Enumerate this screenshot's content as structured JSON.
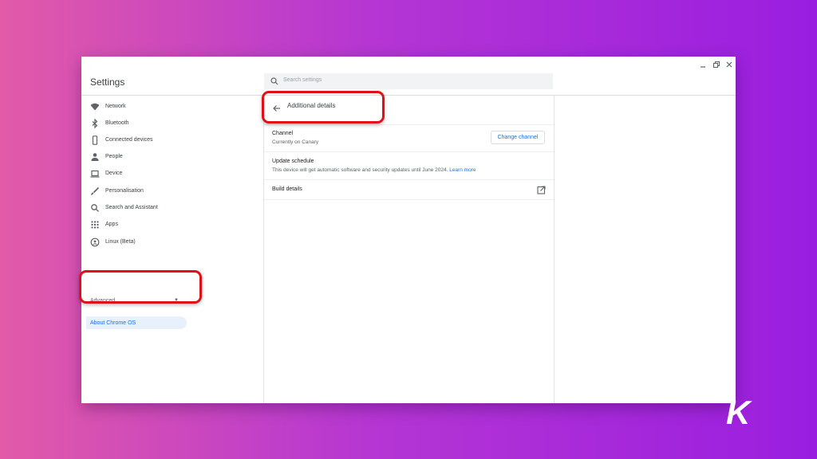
{
  "window": {
    "title": "Settings",
    "search_placeholder": "Search settings",
    "controls": [
      "minimize-icon",
      "restore-icon",
      "close-icon"
    ]
  },
  "sidebar": {
    "items": [
      {
        "label": "Network",
        "icon": "wifi-icon"
      },
      {
        "label": "Bluetooth",
        "icon": "bluetooth-icon"
      },
      {
        "label": "Connected devices",
        "icon": "phone-icon"
      },
      {
        "label": "People",
        "icon": "person-icon"
      },
      {
        "label": "Device",
        "icon": "laptop-icon"
      },
      {
        "label": "Personalisation",
        "icon": "brush-icon"
      },
      {
        "label": "Search and Assistant",
        "icon": "search-icon"
      },
      {
        "label": "Apps",
        "icon": "apps-grid-icon"
      },
      {
        "label": "Linux (Beta)",
        "icon": "linux-icon"
      }
    ],
    "advanced_label": "Advanced",
    "about_label": "About Chrome OS"
  },
  "main": {
    "subpage_title": "Additional details",
    "channel": {
      "label": "Channel",
      "value": "Currently on Canary",
      "button": "Change channel"
    },
    "update_schedule": {
      "label": "Update schedule",
      "text": "This device will get automatic software and security updates until June 2024.",
      "link": "Learn more"
    },
    "build_details": {
      "label": "Build details"
    }
  },
  "colors": {
    "highlight": "#e0101a",
    "accent": "#1a73e8",
    "background_left": "#e25aa8",
    "background_right": "#9a1ee0"
  },
  "watermark": "K"
}
